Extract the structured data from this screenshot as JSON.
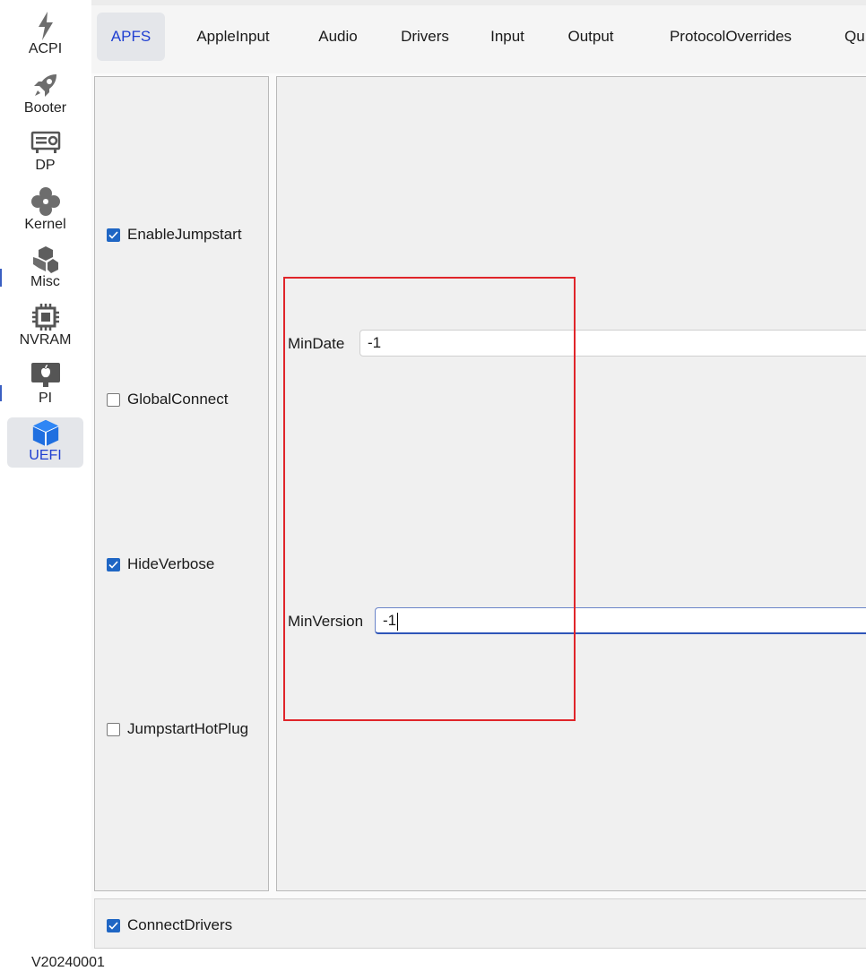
{
  "sidebar": {
    "items": [
      {
        "label": "ACPI",
        "icon": "bolt-icon"
      },
      {
        "label": "Booter",
        "icon": "rocket-icon"
      },
      {
        "label": "DP",
        "icon": "graphics-card-icon"
      },
      {
        "label": "Kernel",
        "icon": "kernel-icon"
      },
      {
        "label": "Misc",
        "icon": "cubes-icon"
      },
      {
        "label": "NVRAM",
        "icon": "chip-icon"
      },
      {
        "label": "PI",
        "icon": "apple-monitor-icon"
      },
      {
        "label": "UEFI",
        "icon": "cube-icon"
      }
    ],
    "active": "UEFI"
  },
  "tabs": [
    "APFS",
    "AppleInput",
    "Audio",
    "Drivers",
    "Input",
    "Output",
    "ProtocolOverrides",
    "Qu"
  ],
  "active_tab": "APFS",
  "apfs": {
    "checkboxes": [
      {
        "label": "EnableJumpstart",
        "checked": true
      },
      {
        "label": "GlobalConnect",
        "checked": false
      },
      {
        "label": "HideVerbose",
        "checked": true
      },
      {
        "label": "JumpstartHotPlug",
        "checked": false
      }
    ],
    "min_date_label": "MinDate",
    "min_date_value": "-1",
    "min_version_label": "MinVersion",
    "min_version_value": "-1"
  },
  "bottom": {
    "connect_drivers_label": "ConnectDrivers",
    "connect_drivers_checked": true
  },
  "version": "V20240001",
  "colors": {
    "accent": "#1f3fd1",
    "checkbox": "#1f66c4",
    "highlight": "#e0252a"
  }
}
